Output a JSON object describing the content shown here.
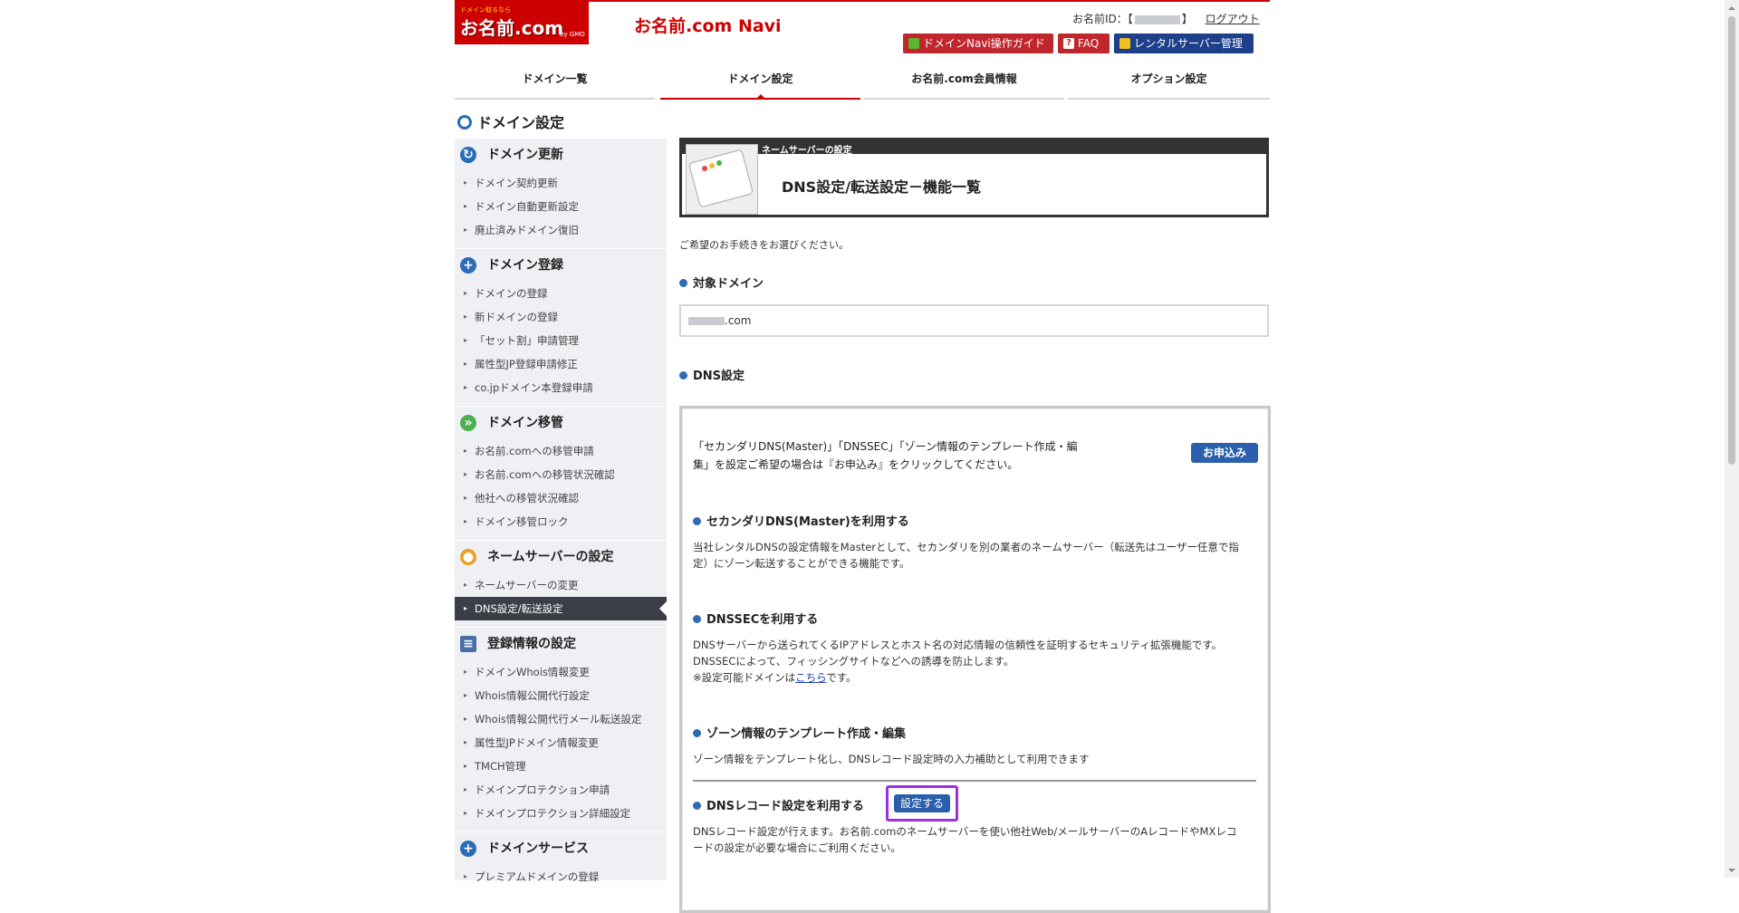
{
  "header": {
    "logo_small": "ドメイン取るなら",
    "logo_main": "お名前.com",
    "logo_gmo": "by GMO",
    "navi_title": "お名前.com Navi",
    "user_id_label": "お名前ID：【",
    "user_id_end": "】",
    "logout": "ログアウト",
    "buttons": [
      {
        "label": "ドメインNavi操作ガイド",
        "color": "#c0272d"
      },
      {
        "label": "FAQ",
        "color": "#c0272d"
      },
      {
        "label": "レンタルサーバー管理",
        "color": "#1e3f8a"
      }
    ]
  },
  "tabs": [
    {
      "label": "ドメイン一覧",
      "active": false
    },
    {
      "label": "ドメイン設定",
      "active": true
    },
    {
      "label": "お名前.com会員情報",
      "active": false
    },
    {
      "label": "オプション設定",
      "active": false
    }
  ],
  "section_title": "ドメイン設定",
  "sidebar": {
    "groups": [
      {
        "title": "ドメイン更新",
        "icon": "refresh-globe-icon",
        "items": [
          "ドメイン契約更新",
          "ドメイン自動更新設定",
          "廃止済みドメイン復旧"
        ]
      },
      {
        "title": "ドメイン登録",
        "icon": "plus-circle-icon",
        "items": [
          "ドメインの登録",
          "新ドメインの登録",
          "「セット割」申請管理",
          "属性型JP登録申請修正",
          "co.jpドメイン本登録申請"
        ]
      },
      {
        "title": "ドメイン移管",
        "icon": "transfer-arrows-icon",
        "items": [
          "お名前.comへの移管申請",
          "お名前.comへの移管状況確認",
          "他社への移管状況確認",
          "ドメイン移管ロック"
        ]
      },
      {
        "title": "ネームサーバーの設定",
        "icon": "server-user-icon",
        "items": [
          "ネームサーバーの変更",
          "DNS設定/転送設定"
        ]
      },
      {
        "title": "登録情報の設定",
        "icon": "document-list-icon",
        "items": [
          "ドメインWhois情報変更",
          "Whois情報公開代行設定",
          "Whois情報公開代行メール転送設定",
          "属性型JPドメイン情報変更",
          "TMCH管理",
          "ドメインプロテクション申請",
          "ドメインプロテクション詳細設定"
        ]
      },
      {
        "title": "ドメインサービス",
        "icon": "plus-circle-icon",
        "items": [
          "プレミアムドメインの登録"
        ]
      }
    ]
  },
  "main": {
    "header_sub": "ネームサーバーの設定",
    "header_title": "DNS設定/転送設定－機能一覧",
    "description": "ご希望のお手続きをお選びください。",
    "target_domain_label": "対象ドメイン",
    "domain_suffix": ".com",
    "dns_label": "DNS設定",
    "intro_text": "「セカンダリDNS(Master)」「DNSSEC」「ゾーン情報のテンプレート作成・編集」を設定ご希望の場合は『お申込み』をクリックしてください。",
    "apply_button": "お申込み",
    "options": [
      {
        "title": "セカンダリDNS(Master)を利用する",
        "desc": "当社レンタルDNSの設定情報をMasterとして、セカンダリを別の業者のネームサーバー（転送先はユーザー任意で指定）にゾーン転送することができる機能です。"
      },
      {
        "title": "DNSSECを利用する",
        "desc_lines": [
          "DNSサーバーから送られてくるIPアドレスとホスト名の対応情報の信頼性を証明するセキュリティ拡張機能です。",
          "DNSSECによって、フィッシングサイトなどへの誘導を防止します。"
        ],
        "note_prefix": "※設定可能ドメインは",
        "note_link": "こちら",
        "note_suffix": "です。"
      },
      {
        "title": "ゾーン情報のテンプレート作成・編集",
        "desc": "ゾーン情報をテンプレート化し、DNSレコード設定時の入力補助として利用できます"
      },
      {
        "title": "DNSレコード設定を利用する",
        "button": "設定する",
        "desc": "DNSレコード設定が行えます。お名前.comのネームサーバーを使い他社Web/メールサーバーのAレコードやMXレコードの設定が必要な場合にご利用ください。"
      }
    ]
  }
}
